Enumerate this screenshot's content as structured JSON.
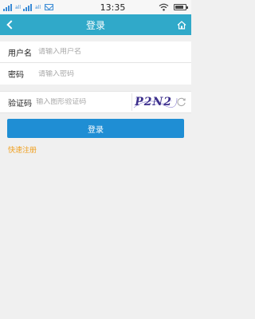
{
  "status_bar": {
    "sim1_label": "all",
    "sim2_label": "all",
    "time": "13:35"
  },
  "app_bar": {
    "title": "登录",
    "back_icon": "chevron-left-icon",
    "home_icon": "home-icon"
  },
  "form": {
    "username": {
      "label": "用户名",
      "placeholder": "请输入用户名",
      "value": ""
    },
    "password": {
      "label": "密码",
      "placeholder": "请输入密码",
      "value": ""
    },
    "captcha": {
      "label": "验证码",
      "placeholder": "输入图形验证码",
      "value": "",
      "image_text": "P2N2"
    }
  },
  "actions": {
    "login_label": "登录",
    "register_label": "快速注册"
  },
  "colors": {
    "app_bar": "#30a9c9",
    "login_button": "#1f8ed4",
    "register_link": "#f0a020"
  }
}
